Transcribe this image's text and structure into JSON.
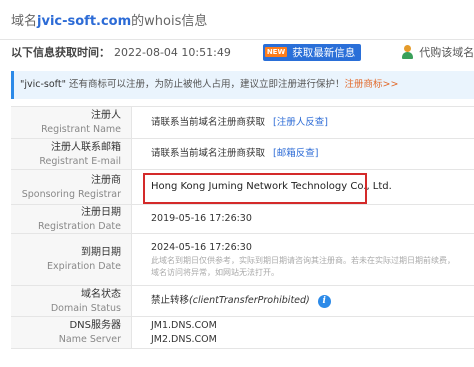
{
  "title": {
    "domain": "jvic-soft.com",
    "prefix": "域名",
    "suffix": "的whois信息"
  },
  "info": {
    "label": "以下信息获取时间：",
    "time": "2022-08-04 10:51:49",
    "new_badge": "NEW",
    "refresh_label": "获取最新信息",
    "buy_label": "代购该域名"
  },
  "notice": {
    "quoted_name": "\"jvic-soft\"",
    "text": " 还有商标可以注册，为防止被他人占用，建议立即注册进行保护！",
    "link": "注册商标>>"
  },
  "rows": [
    {
      "zh": "注册人",
      "en": "Registrant Name",
      "value": "请联系当前域名注册商获取",
      "link": "[注册人反查]"
    },
    {
      "zh": "注册人联系邮箱",
      "en": "Registrant E-mail",
      "value": "请联系当前域名注册商获取",
      "link": "[邮箱反查]"
    },
    {
      "zh": "注册商",
      "en": "Sponsoring Registrar",
      "value": "Hong Kong Juming Network Technology Co., Ltd."
    },
    {
      "zh": "注册日期",
      "en": "Registration Date",
      "value": "2019-05-16 17:26:30"
    },
    {
      "zh": "到期日期",
      "en": "Expiration Date",
      "value": "2024-05-16 17:26:30",
      "note1": "此域名到期日仅供参考，实际到期日期请咨询其注册商。若未在实际过期日期前续费，",
      "note2": "域名访问将异常，如网站无法打开。"
    },
    {
      "zh": "域名状态",
      "en": "Domain Status",
      "value_prefix": "禁止转移",
      "value_italic": "(clientTransferProhibited)"
    },
    {
      "zh": "DNS服务器",
      "en": "Name Server",
      "ns1": "JM1.DNS.COM",
      "ns2": "JM2.DNS.COM"
    }
  ],
  "colors": {
    "accent": "#2c6bd6",
    "highlight": "#d42a2a",
    "orange": "#e26a2c"
  }
}
